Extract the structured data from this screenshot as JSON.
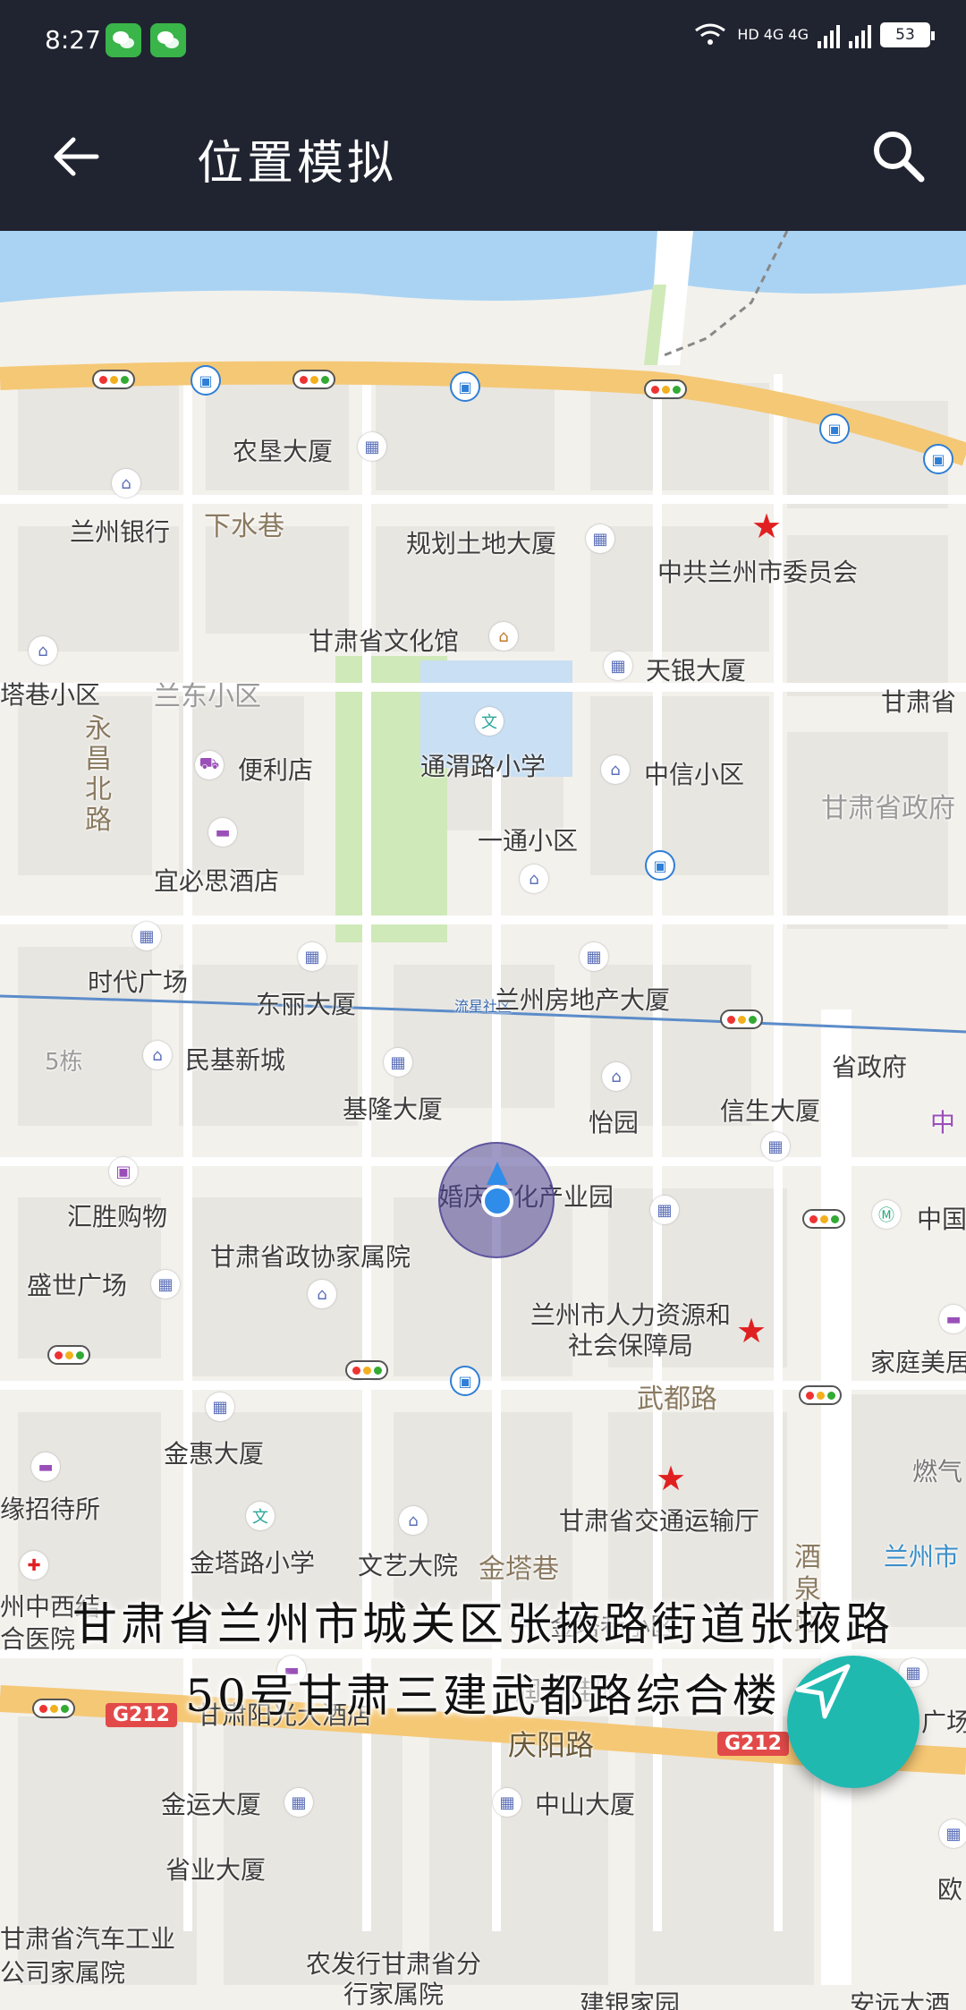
{
  "status_bar": {
    "time": "8:27",
    "network": "HD 4G 4G",
    "battery": "53"
  },
  "app_bar": {
    "title": "位置模拟"
  },
  "map": {
    "pois": [
      {
        "label": "农垦大厦",
        "kind": "building"
      },
      {
        "label": "兰州银行",
        "kind": "home"
      },
      {
        "label": "下水巷",
        "kind": "road"
      },
      {
        "label": "规划土地大厦",
        "kind": "building"
      },
      {
        "label": "中共兰州市委员会",
        "kind": "star"
      },
      {
        "label": "甘肃省文化馆",
        "kind": "museum"
      },
      {
        "label": "天银大厦",
        "kind": "building"
      },
      {
        "label": "塔巷小区",
        "kind": "home"
      },
      {
        "label": "兰东小区",
        "kind": "area"
      },
      {
        "label": "甘肃省",
        "kind": "text"
      },
      {
        "label": "永昌北路",
        "kind": "road"
      },
      {
        "label": "便利店",
        "kind": "shop"
      },
      {
        "label": "通渭路小学",
        "kind": "school"
      },
      {
        "label": "中信小区",
        "kind": "home"
      },
      {
        "label": "甘肃省政府",
        "kind": "area"
      },
      {
        "label": "一通小区",
        "kind": "home"
      },
      {
        "label": "宜必思酒店",
        "kind": "hotel"
      },
      {
        "label": "时代广场",
        "kind": "building"
      },
      {
        "label": "东丽大厦",
        "kind": "building"
      },
      {
        "label": "流星社区",
        "kind": "tag"
      },
      {
        "label": "兰州房地产大厦",
        "kind": "building"
      },
      {
        "label": "省政府",
        "kind": "text"
      },
      {
        "label": "5栋",
        "kind": "area"
      },
      {
        "label": "民基新城",
        "kind": "home"
      },
      {
        "label": "基隆大厦",
        "kind": "building"
      },
      {
        "label": "怡园",
        "kind": "home"
      },
      {
        "label": "信生大厦",
        "kind": "building"
      },
      {
        "label": "中",
        "kind": "text"
      },
      {
        "label": "汇胜购物",
        "kind": "shop"
      },
      {
        "label": "婚庆文化产业园",
        "kind": "building"
      },
      {
        "label": "中国",
        "kind": "text"
      },
      {
        "label": "盛世广场",
        "kind": "building"
      },
      {
        "label": "甘肃省政协家属院",
        "kind": "home"
      },
      {
        "label": "兰州市人力资源和社会保障局",
        "kind": "star"
      },
      {
        "label": "家庭美居",
        "kind": "text"
      },
      {
        "label": "武都路",
        "kind": "road"
      },
      {
        "label": "金惠大厦",
        "kind": "building"
      },
      {
        "label": "燃气",
        "kind": "text"
      },
      {
        "label": "缘招待所",
        "kind": "hotel"
      },
      {
        "label": "甘肃省交通运输厅",
        "kind": "star"
      },
      {
        "label": "兰州市",
        "kind": "text"
      },
      {
        "label": "金塔路小学",
        "kind": "school"
      },
      {
        "label": "文艺大院",
        "kind": "home"
      },
      {
        "label": "金塔巷",
        "kind": "road"
      },
      {
        "label": "酒泉路",
        "kind": "road"
      },
      {
        "label": "州中西结合医院",
        "kind": "hospital"
      },
      {
        "label": "金塔巷小区",
        "kind": "home"
      },
      {
        "label": "润城佳园",
        "kind": "area"
      },
      {
        "label": "甘肃阳光大酒店",
        "kind": "hotel"
      },
      {
        "label": "广场",
        "kind": "text"
      },
      {
        "label": "庆阳路",
        "kind": "road"
      },
      {
        "label": "G212",
        "kind": "highway"
      },
      {
        "label": "金运大厦",
        "kind": "building"
      },
      {
        "label": "中山大厦",
        "kind": "building"
      },
      {
        "label": "省业大厦",
        "kind": "building"
      },
      {
        "label": "甘肃省汽车工业公司家属院",
        "kind": "home"
      },
      {
        "label": "农发行甘肃省分行家属院",
        "kind": "home"
      },
      {
        "label": "建银家园",
        "kind": "home"
      },
      {
        "label": "安远大酒",
        "kind": "hotel"
      },
      {
        "label": "欧",
        "kind": "text"
      }
    ]
  },
  "address": {
    "line1": "甘肃省兰州市城关区张掖路街道张掖路",
    "line2": "50号甘肃三建武都路综合楼"
  }
}
